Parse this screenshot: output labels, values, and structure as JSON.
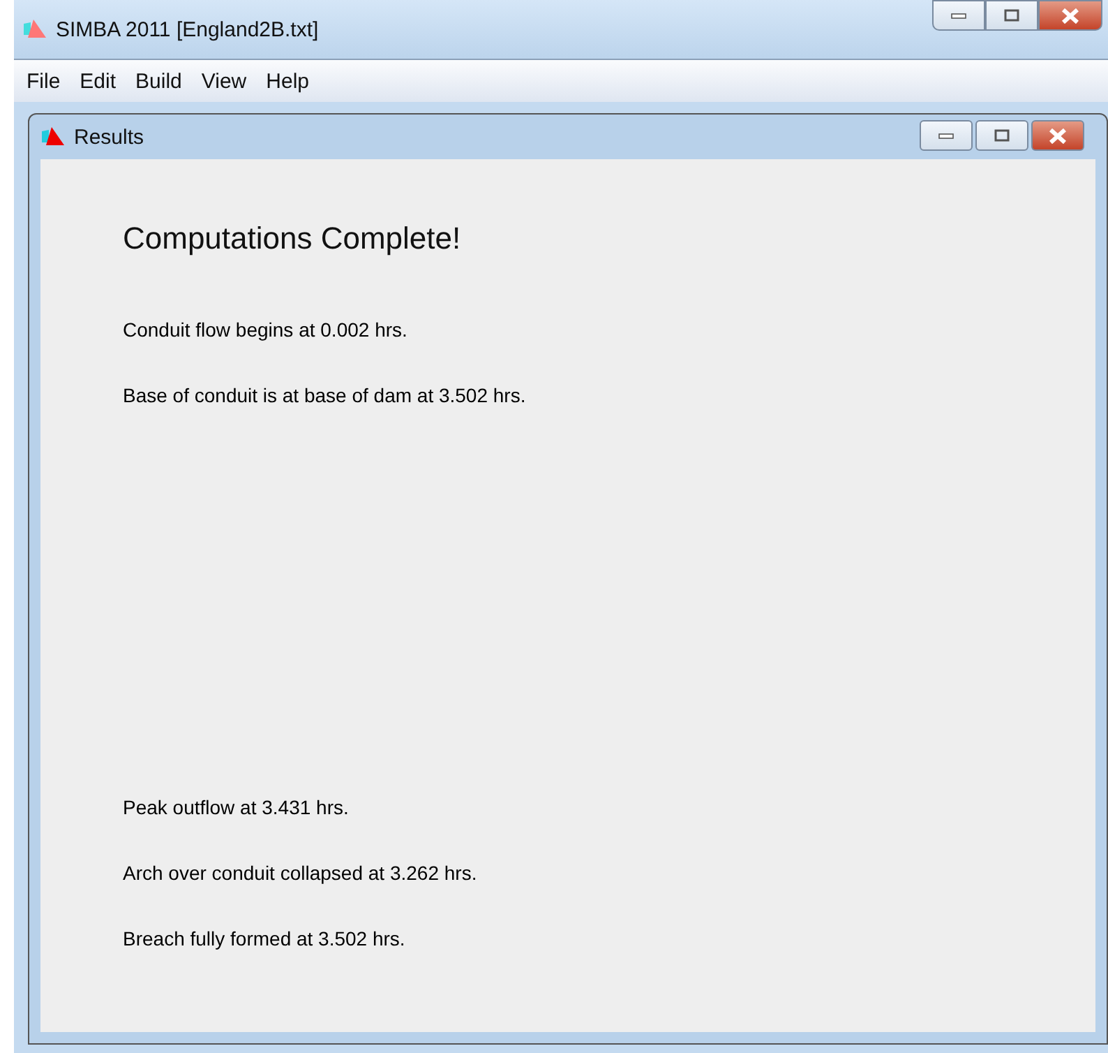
{
  "window": {
    "title": "SIMBA 2011 [England2B.txt]"
  },
  "menu": [
    "File",
    "Edit",
    "Build",
    "View",
    "Help"
  ],
  "results_window": {
    "title": "Results",
    "heading": "Computations Complete!",
    "groups": [
      {
        "lines": [
          "Conduit flow begins at 0.002 hrs.",
          "Base of conduit is at base of dam at 3.502 hrs."
        ]
      },
      {
        "lines": [
          "Peak outflow at 3.431 hrs.",
          "Arch over conduit collapsed at 3.262 hrs.",
          "Breach fully formed at 3.502 hrs."
        ]
      }
    ]
  }
}
